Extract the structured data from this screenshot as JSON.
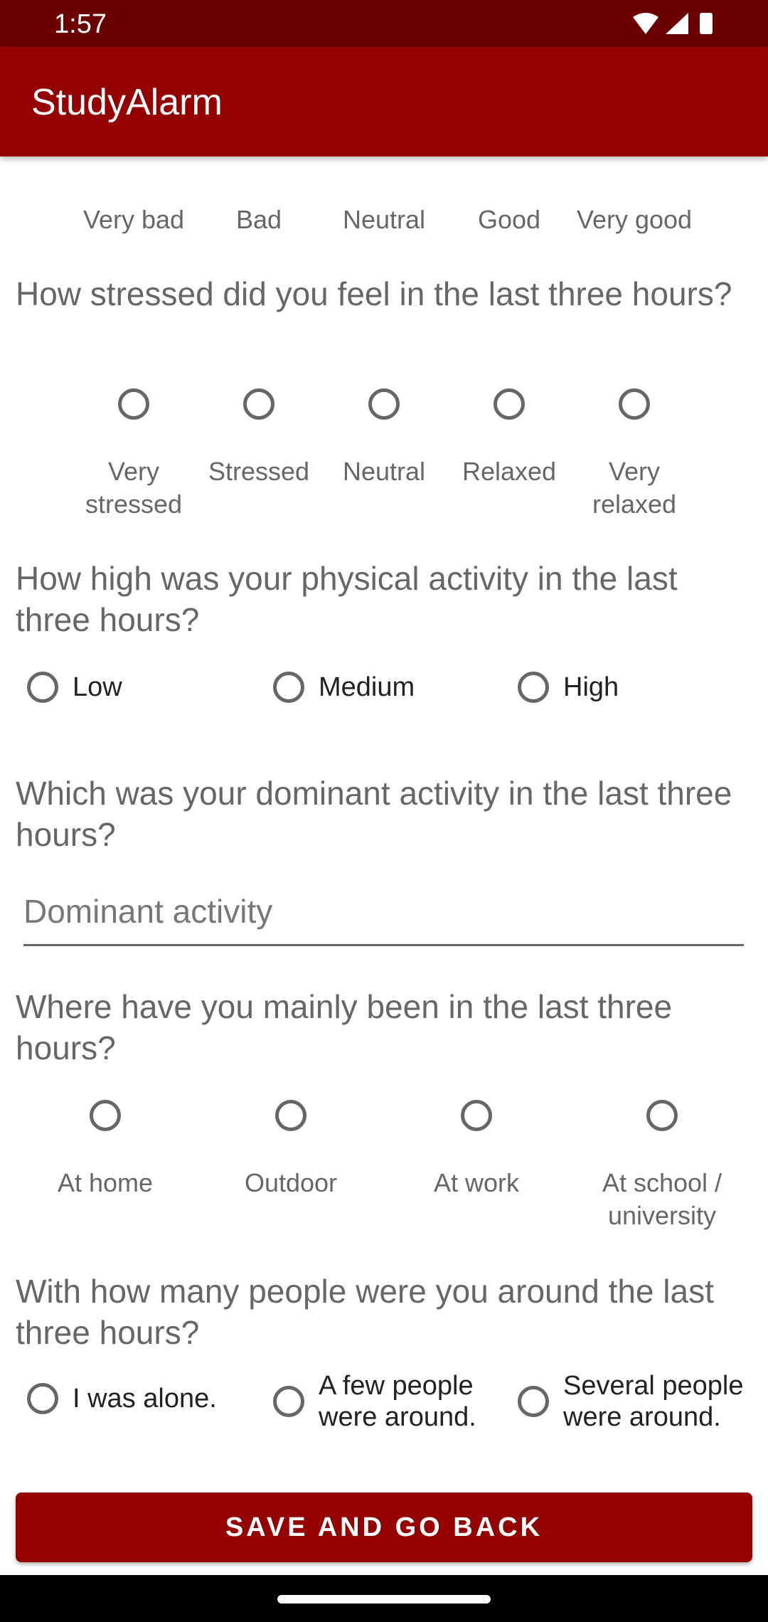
{
  "status_bar": {
    "time": "1:57",
    "icons": [
      "wifi-icon",
      "cellular-signal-icon",
      "battery-icon"
    ]
  },
  "app_bar": {
    "title": "StudyAlarm"
  },
  "colors": {
    "primary": "#950000",
    "primary_dark": "#6b0000",
    "question_text": "#666666",
    "radio_outline": "#666666"
  },
  "q_mood": {
    "options": [
      "Very bad",
      "Bad",
      "Neutral",
      "Good",
      "Very good"
    ],
    "selected": null
  },
  "q_stress": {
    "question": "How stressed did you feel in the last three hours?",
    "options": [
      "Very stressed",
      "Stressed",
      "Neutral",
      "Relaxed",
      "Very relaxed"
    ],
    "selected": null
  },
  "q_physical": {
    "question": "How high was your physical activity in the last three hours?",
    "options": [
      "Low",
      "Medium",
      "High"
    ],
    "selected": null
  },
  "q_dominant": {
    "question": "Which was your dominant activity in the last three hours?",
    "placeholder": "Dominant activity",
    "value": ""
  },
  "q_location": {
    "question": "Where have you mainly been in the last three hours?",
    "options": [
      "At home",
      "Outdoor",
      "At work",
      "At school / university"
    ],
    "selected": null
  },
  "q_people": {
    "question": "With how many people were you around the last three hours?",
    "options": [
      "I was alone.",
      "A few people were around.",
      "Several people were around."
    ],
    "selected": null
  },
  "save_button": {
    "label": "SAVE AND GO BACK"
  }
}
